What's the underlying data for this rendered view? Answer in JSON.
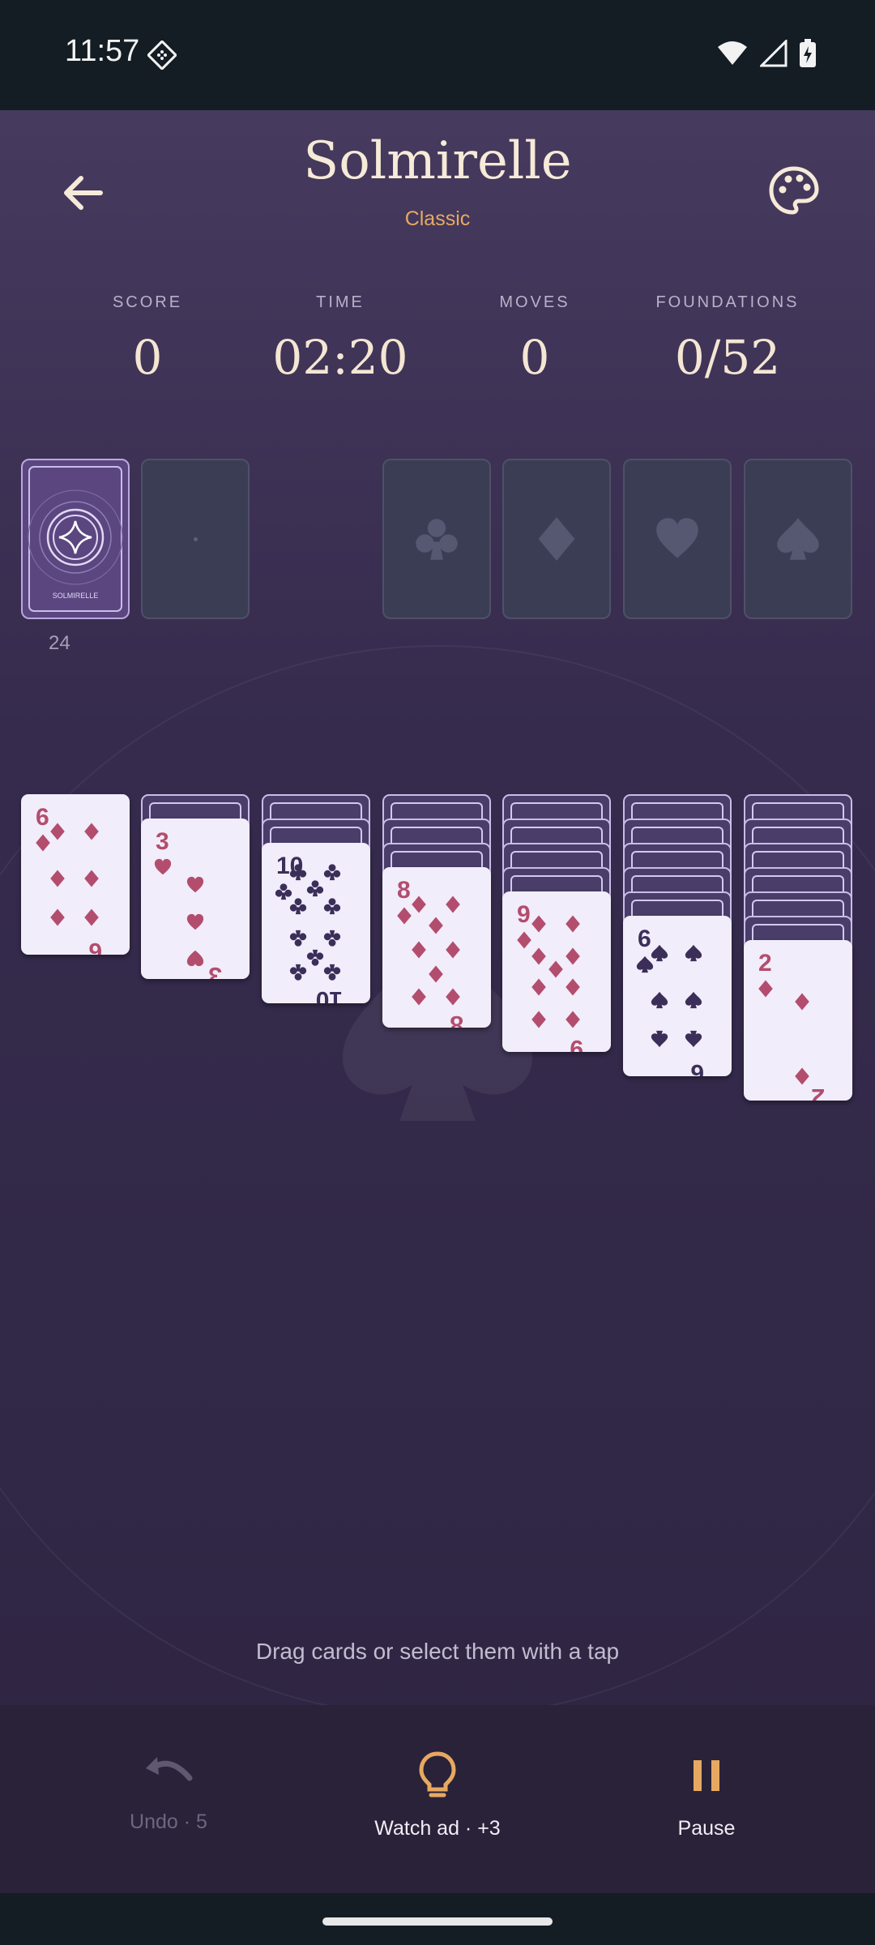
{
  "status_bar": {
    "time": "11:57"
  },
  "header": {
    "title": "Solmirelle",
    "subtitle": "Classic"
  },
  "stats": {
    "score_label": "SCORE",
    "score_value": "0",
    "time_label": "TIME",
    "time_value": "02:20",
    "moves_label": "MOVES",
    "moves_value": "0",
    "foundations_label": "FOUNDATIONS",
    "foundations_value": "0/52"
  },
  "stock": {
    "count": "24",
    "brand": "SOLMIRELLE"
  },
  "foundations": [
    "club",
    "diamond",
    "heart",
    "spade"
  ],
  "tableau": [
    {
      "hidden": 0,
      "rank": "6",
      "suit": "diamond"
    },
    {
      "hidden": 1,
      "rank": "3",
      "suit": "heart"
    },
    {
      "hidden": 2,
      "rank": "10",
      "suit": "club"
    },
    {
      "hidden": 3,
      "rank": "8",
      "suit": "diamond"
    },
    {
      "hidden": 4,
      "rank": "9",
      "suit": "diamond"
    },
    {
      "hidden": 5,
      "rank": "6",
      "suit": "spade"
    },
    {
      "hidden": 6,
      "rank": "2",
      "suit": "diamond"
    }
  ],
  "hint": "Drag cards or select them with a tap",
  "actions": {
    "undo_label": "Undo · 5",
    "hint_label": "Watch ad · +3",
    "pause_label": "Pause"
  },
  "colors": {
    "red_suit": "#b34d6e",
    "black_suit": "#3b2f5a",
    "accent": "#e7a961"
  }
}
